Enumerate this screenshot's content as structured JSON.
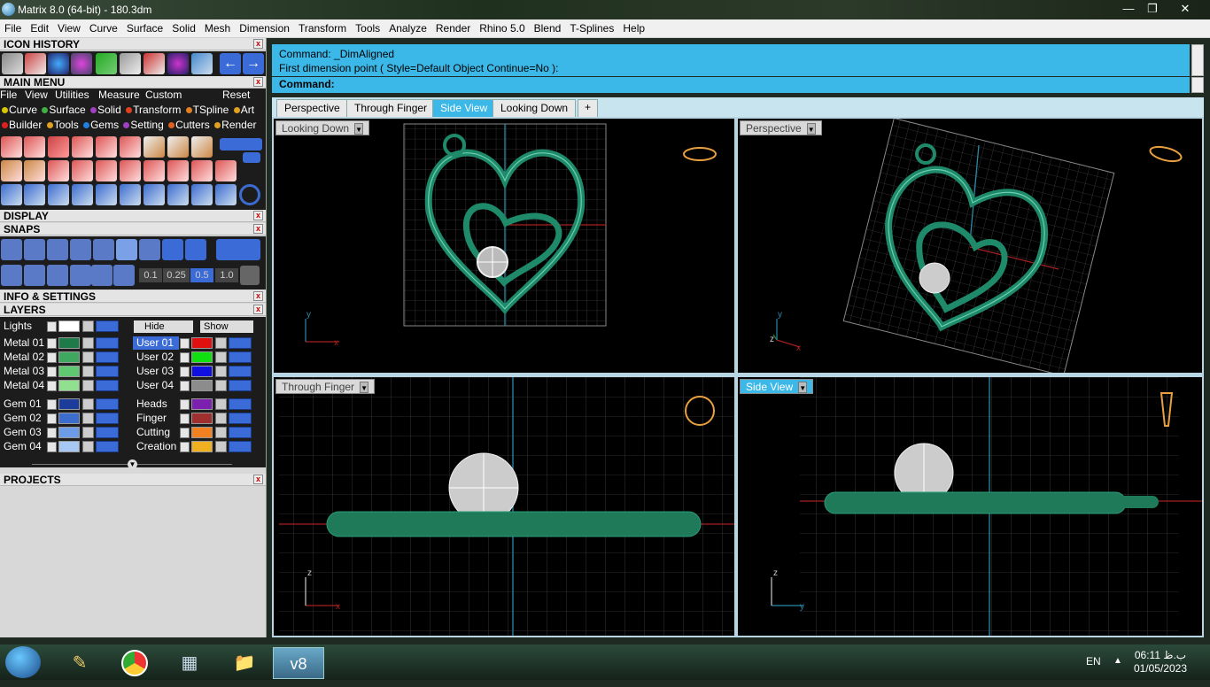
{
  "window": {
    "title": "Matrix 8.0 (64-bit) - 180.3dm"
  },
  "menu": [
    "File",
    "Edit",
    "View",
    "Curve",
    "Surface",
    "Solid",
    "Mesh",
    "Dimension",
    "Transform",
    "Tools",
    "Analyze",
    "Render",
    "Rhino 5.0",
    "Blend",
    "T-Splines",
    "Help"
  ],
  "panels": {
    "icon_history": "ICON HISTORY",
    "main_menu": "MAIN MENU",
    "display": "DISPLAY",
    "snaps": "SNAPS",
    "info_settings": "INFO & SETTINGS",
    "layers": "LAYERS",
    "projects": "PROJECTS"
  },
  "main_menu": {
    "row1": [
      "File",
      "View",
      "Utilities",
      "Measure",
      "Custom"
    ],
    "reset": "Reset",
    "row2": [
      {
        "label": "Curve",
        "color": "#d8c800"
      },
      {
        "label": "Surface",
        "color": "#40b040"
      },
      {
        "label": "Solid",
        "color": "#a040c0"
      },
      {
        "label": "Transform",
        "color": "#e04020"
      },
      {
        "label": "TSpline",
        "color": "#e08020"
      },
      {
        "label": "Art",
        "color": "#e0a020"
      }
    ],
    "row3": [
      {
        "label": "Builder",
        "color": "#e02020"
      },
      {
        "label": "Tools",
        "color": "#e0a020"
      },
      {
        "label": "Gems",
        "color": "#2080e0"
      },
      {
        "label": "Setting",
        "color": "#a040c0"
      },
      {
        "label": "Cutters",
        "color": "#e06020"
      },
      {
        "label": "Render",
        "color": "#e0a020"
      }
    ]
  },
  "snaps": {
    "values": [
      "0.1",
      "0.25",
      "0.5",
      "1.0"
    ]
  },
  "layers": {
    "lights": "Lights",
    "hide": "Hide",
    "show": "Show",
    "left": [
      {
        "name": "Metal 01",
        "color": "#1f7a4a"
      },
      {
        "name": "Metal 02",
        "color": "#3fa860"
      },
      {
        "name": "Metal 03",
        "color": "#60c870"
      },
      {
        "name": "Metal 04",
        "color": "#90e090"
      },
      {
        "name": "Gem 01",
        "color": "#1c3c9c"
      },
      {
        "name": "Gem 02",
        "color": "#3c6ccc"
      },
      {
        "name": "Gem 03",
        "color": "#6c9ce8"
      },
      {
        "name": "Gem 04",
        "color": "#a8c8f4"
      }
    ],
    "right": [
      {
        "name": "User 01",
        "color": "#e01010"
      },
      {
        "name": "User 02",
        "color": "#10e010"
      },
      {
        "name": "User 03",
        "color": "#1010e0"
      },
      {
        "name": "User 04",
        "color": "#8c8c8c"
      },
      {
        "name": "Heads",
        "color": "#7c20b0"
      },
      {
        "name": "Finger",
        "color": "#a03030"
      },
      {
        "name": "Cutting",
        "color": "#f08020"
      },
      {
        "name": "Creation",
        "color": "#f0b020"
      }
    ]
  },
  "command": {
    "line1": "Command: _DimAligned",
    "line2": "First dimension point ( Style=Default  Object  Continue=No ):",
    "prompt": "Command:"
  },
  "tabs": [
    "Perspective",
    "Through Finger",
    "Side View",
    "Looking Down"
  ],
  "active_tab": "Side View",
  "tab_add": "+",
  "viewports": {
    "top_left": "Looking Down",
    "top_right": "Perspective",
    "bottom_left": "Through Finger",
    "bottom_right": "Side View"
  },
  "axes": {
    "x": "x",
    "y": "y",
    "z": "z"
  },
  "colors": {
    "accent": "#3cb8e8",
    "model": "#1f8a6a"
  },
  "taskbar": {
    "lang": "EN",
    "time": "06:11 ب.ظ",
    "date": "01/05/2023",
    "active_app": "v8"
  }
}
